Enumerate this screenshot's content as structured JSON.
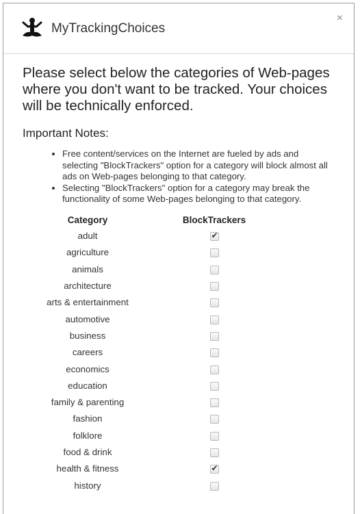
{
  "header": {
    "title": "MyTrackingChoices",
    "close_glyph": "×",
    "logo_icon": "meditating-person-icon"
  },
  "intro": "Please select below the categories of Web-pages where you don't want to be tracked. Your choices will be technically enforced.",
  "notes": {
    "heading": "Important Notes:",
    "items": [
      "Free content/services on the Internet are fueled by ads and selecting \"BlockTrackers\" option for a category will block almost all ads on Web-pages belonging to that category.",
      "Selecting \"BlockTrackers\" option for a category may break the functionality of some Web-pages belonging to that category."
    ]
  },
  "table": {
    "headers": {
      "category": "Category",
      "block": "BlockTrackers"
    },
    "rows": [
      {
        "category": "adult",
        "checked": true
      },
      {
        "category": "agriculture",
        "checked": false
      },
      {
        "category": "animals",
        "checked": false
      },
      {
        "category": "architecture",
        "checked": false
      },
      {
        "category": "arts & entertainment",
        "checked": false
      },
      {
        "category": "automotive",
        "checked": false
      },
      {
        "category": "business",
        "checked": false
      },
      {
        "category": "careers",
        "checked": false
      },
      {
        "category": "economics",
        "checked": false
      },
      {
        "category": "education",
        "checked": false
      },
      {
        "category": "family & parenting",
        "checked": false
      },
      {
        "category": "fashion",
        "checked": false
      },
      {
        "category": "folklore",
        "checked": false
      },
      {
        "category": "food & drink",
        "checked": false
      },
      {
        "category": "health & fitness",
        "checked": true
      },
      {
        "category": "history",
        "checked": false
      }
    ]
  }
}
